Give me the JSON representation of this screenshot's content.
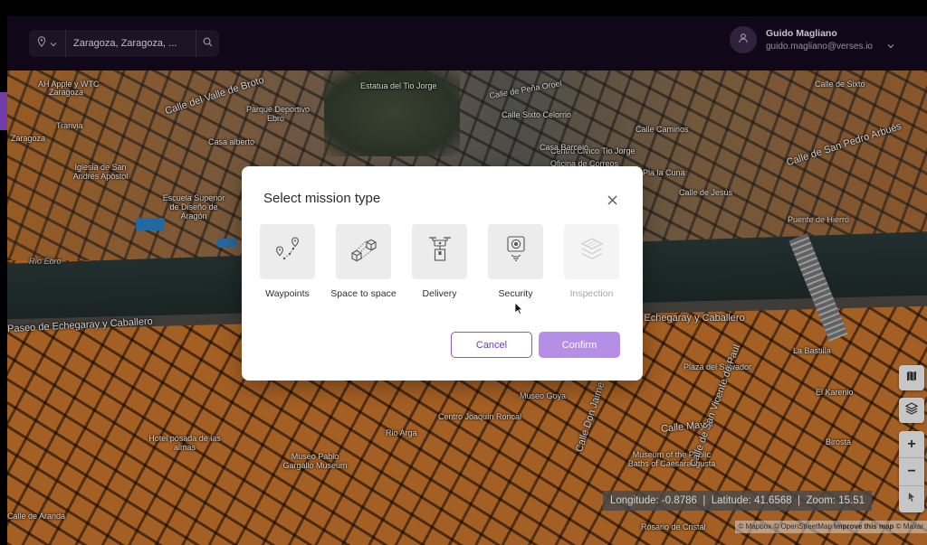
{
  "search": {
    "value": "Zaragoza, Zaragoza, ..."
  },
  "user": {
    "name": "Guido Magliano",
    "email": "guido.magliano@verses.io"
  },
  "map": {
    "labels": [
      "AH Apple y WTC",
      "Zaragoza",
      "Calle del Valle de Broto",
      "Tranvia",
      "Parque Deportivo",
      "Ebro",
      "Estatua del Tio Jorge",
      "Calle de Peña Oroel",
      "Calle Sixto Celorrio",
      "Centro Civico Tio Jorge",
      "Iglesia de San Andrés Apóstol",
      "Casa alberto",
      "Escuela Superior de Diseño de Aragón",
      "Río Ebro",
      "Paseo de Echegaray y Caballero",
      "La Bastilla",
      "Plaza del Salvador",
      "El Karenio",
      "Museo Goya",
      "Centro Joaquín Roncal",
      "Rio Arga",
      "Calle Mayor",
      "Birosta",
      "Hotel posada de las almas",
      "Museo Pablo Gargallo Museum",
      "Museum of the Public Baths of Caesaraugusta",
      "Calle de San Vicente de Paul",
      "Calle Don Jaime",
      "Calle de Aranda",
      "Rosario de Cristal",
      "Calle de San Pedro Arbués",
      "Calle de Jesús",
      "Puente de Hierro",
      "Calle de Sixto",
      "Calle Caminos",
      "Oficina de Correos",
      "Pla la Cuna",
      "Calle de Echegaray y Caballero",
      "Casa Barceló",
      "Zaragoza"
    ],
    "coords": {
      "longitude_label": "Longitude:",
      "longitude": "-0.8786",
      "latitude_label": "Latitude:",
      "latitude": "41.6568",
      "zoom_label": "Zoom:",
      "zoom": "15.51"
    },
    "attribution": {
      "mapbox": "© Mapbox",
      "osm": "© OpenStreetMap",
      "improve": "Improve this map",
      "maxar": "© Maxar"
    },
    "zoom_in": "+",
    "zoom_out": "−"
  },
  "modal": {
    "title": "Select mission type",
    "missions": [
      {
        "label": "Waypoints",
        "icon": "waypoints-icon",
        "enabled": true
      },
      {
        "label": "Space to space",
        "icon": "space-to-space-icon",
        "enabled": true
      },
      {
        "label": "Delivery",
        "icon": "delivery-drone-icon",
        "enabled": true
      },
      {
        "label": "Security",
        "icon": "security-camera-icon",
        "enabled": true
      },
      {
        "label": "Inspection",
        "icon": "inspection-layers-icon",
        "enabled": false
      }
    ],
    "cancel_label": "Cancel",
    "confirm_label": "Confirm"
  },
  "colors": {
    "accent": "#8a55cf",
    "confirm_bg": "#b58ee6",
    "topbar_bg": "#140a1e",
    "building_orange": "#c9752d"
  }
}
